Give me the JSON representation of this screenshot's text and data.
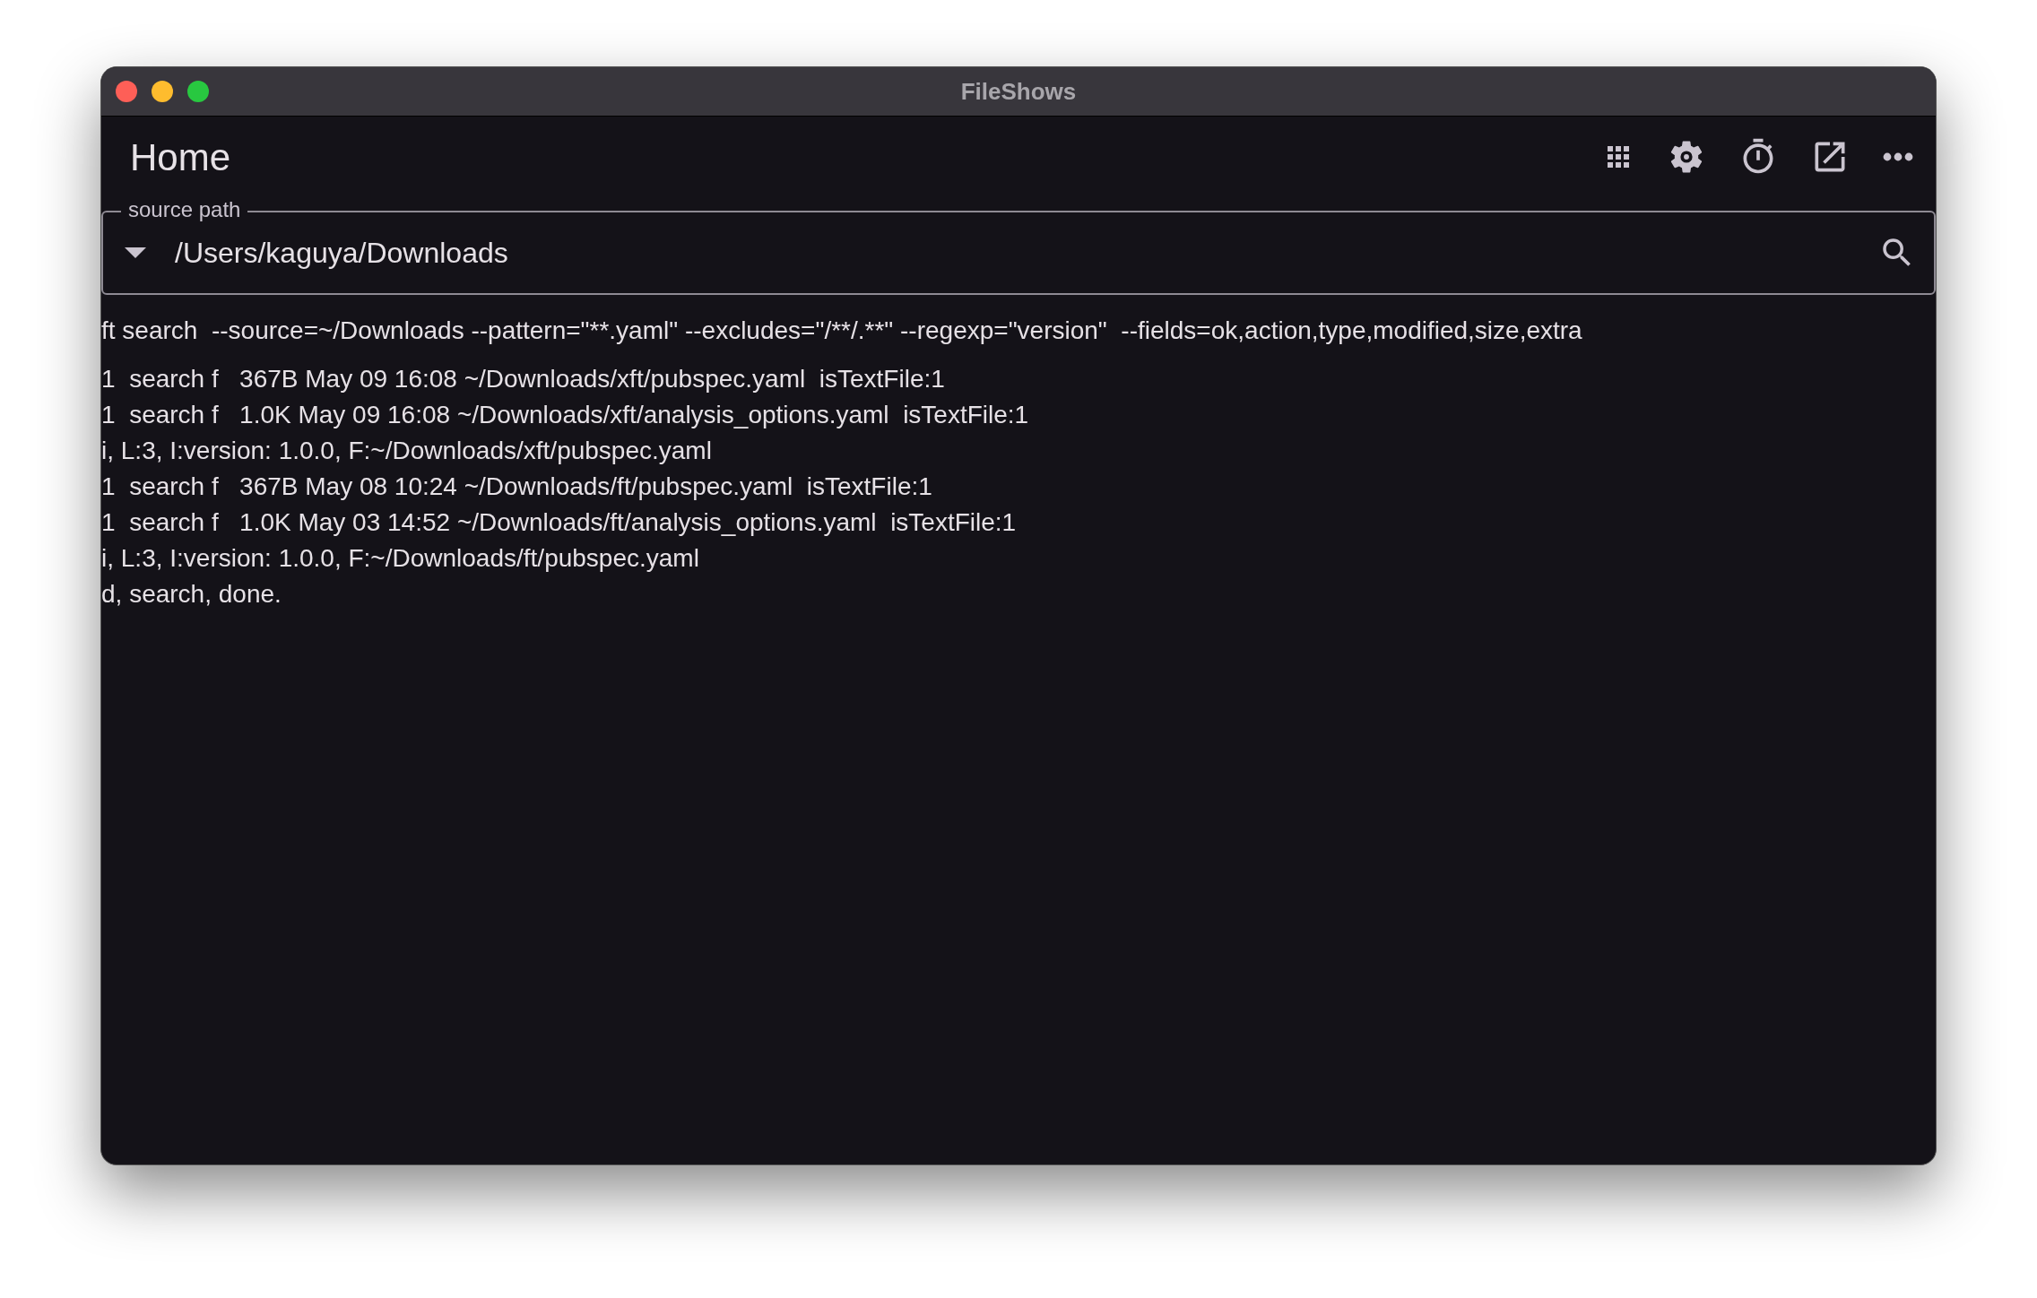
{
  "window": {
    "title": "FileShows"
  },
  "header": {
    "title": "Home"
  },
  "source_path": {
    "label": "source path",
    "value": "/Users/kaguya/Downloads"
  },
  "command": "ft search  --source=~/Downloads --pattern=\"**.yaml\" --excludes=\"/**/.**\" --regexp=\"version\"  --fields=ok,action,type,modified,size,extra",
  "output_lines": [
    "1  search f   367B May 09 16:08 ~/Downloads/xft/pubspec.yaml  isTextFile:1",
    "1  search f   1.0K May 09 16:08 ~/Downloads/xft/analysis_options.yaml  isTextFile:1",
    "i, L:3, I:version: 1.0.0, F:~/Downloads/xft/pubspec.yaml",
    "1  search f   367B May 08 10:24 ~/Downloads/ft/pubspec.yaml  isTextFile:1",
    "1  search f   1.0K May 03 14:52 ~/Downloads/ft/analysis_options.yaml  isTextFile:1",
    "i, L:3, I:version: 1.0.0, F:~/Downloads/ft/pubspec.yaml",
    "d, search, done."
  ]
}
